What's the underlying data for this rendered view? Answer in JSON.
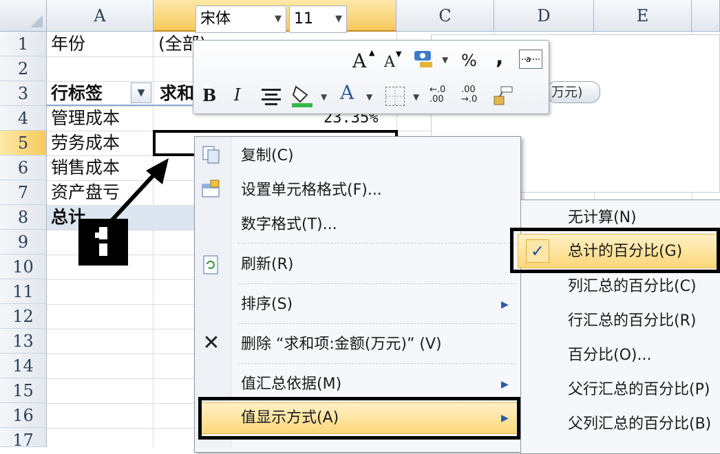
{
  "columns": [
    "A",
    "B",
    "C",
    "D",
    "E"
  ],
  "rows": [
    "1",
    "2",
    "3",
    "4",
    "5",
    "6",
    "7",
    "8",
    "9",
    "10",
    "11",
    "12",
    "13",
    "14",
    "15",
    "16",
    "17"
  ],
  "cells": {
    "a1": "年份",
    "b1": "(全部)",
    "a3": "行标签",
    "b3": "求和",
    "a4": "管理成本",
    "b4": "23.35%",
    "a5": "劳务成本",
    "a6": "销售成本",
    "a7": "资产盘亏",
    "a8": "总计"
  },
  "chart_field_button": "万元)",
  "mini_toolbar": {
    "font_name": "宋体",
    "font_size": "11",
    "grow_font": "A",
    "shrink_font": "A",
    "percent": "%",
    "comma": ",",
    "bold": "B",
    "italic": "I",
    "font_color": "A",
    "inc_decimal": "←.0 .00",
    "dec_decimal": ".00 →.0"
  },
  "context_menu": {
    "items": [
      {
        "label": "复制(C)",
        "icon": "copy-icon"
      },
      {
        "label": "设置单元格格式(F)...",
        "icon": "format-cells-icon"
      },
      {
        "label": "数字格式(T)..."
      },
      {
        "label": "刷新(R)",
        "icon": "refresh-icon"
      },
      {
        "label": "排序(S)",
        "has_submenu": true
      },
      {
        "label": "删除 “求和项:金额(万元)” (V)",
        "icon": "delete-x-icon"
      },
      {
        "label": "值汇总依据(M)",
        "has_submenu": true
      },
      {
        "label": "值显示方式(A)",
        "has_submenu": true,
        "highlighted": true
      }
    ]
  },
  "submenu": {
    "items": [
      {
        "label": "无计算(N)"
      },
      {
        "label": "总计的百分比(G)",
        "checked": true,
        "highlighted": true
      },
      {
        "label": "列汇总的百分比(C)"
      },
      {
        "label": "行汇总的百分比(R)"
      },
      {
        "label": "百分比(O)..."
      },
      {
        "label": "父行汇总的百分比(P)"
      },
      {
        "label": "父列汇总的百分比(B)"
      }
    ]
  },
  "annotation": {
    "number": "1"
  },
  "colors": {
    "highlight": "#fcd77a",
    "selected_header": "#f7c95c",
    "accent": "#1e4d9b"
  }
}
